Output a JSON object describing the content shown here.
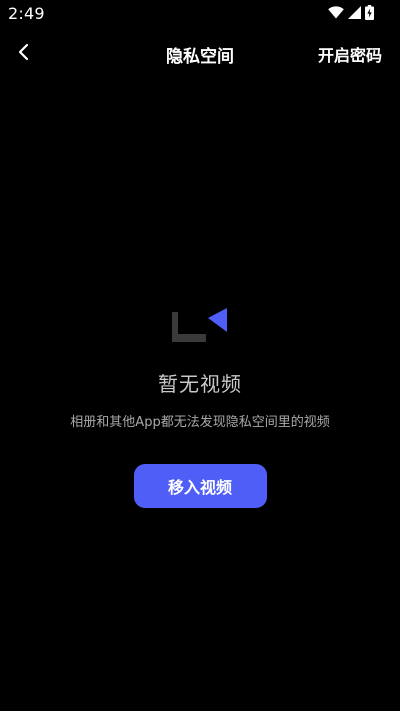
{
  "status_bar": {
    "time": "2:49",
    "icons": [
      "wifi-icon",
      "cell-signal-icon",
      "battery-charging-icon"
    ]
  },
  "nav": {
    "back_icon": "chevron-left-icon",
    "title": "隐私空间",
    "action_label": "开启密码"
  },
  "empty_state": {
    "icon": "video-placeholder-icon",
    "title": "暂无视频",
    "description": "相册和其他App都无法发现隐私空间里的视频",
    "button_label": "移入视频"
  },
  "colors": {
    "background": "#000000",
    "accent": "#4f5ef7",
    "icon_gray": "#3a3a3a",
    "text_primary": "#ffffff",
    "text_secondary": "#a9a9a9"
  }
}
